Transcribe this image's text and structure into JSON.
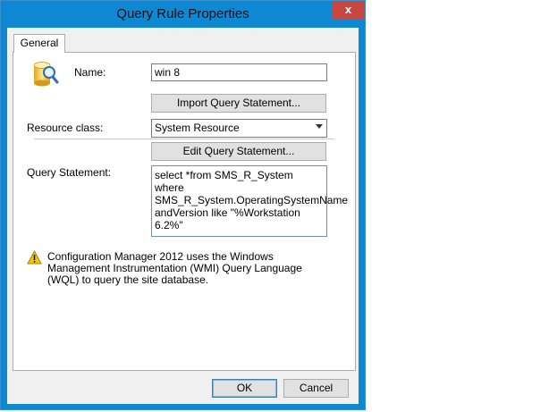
{
  "window": {
    "title": "Query Rule Properties",
    "close_glyph": "x"
  },
  "tabs": [
    {
      "label": "General"
    }
  ],
  "form": {
    "name_label": "Name:",
    "name_value": "win 8",
    "import_button": "Import Query Statement...",
    "resource_class_label": "Resource class:",
    "resource_class_value": "System Resource",
    "edit_button": "Edit Query Statement...",
    "query_statement_label": "Query Statement:",
    "query_statement_value": "select *from SMS_R_System where SMS_R_System.OperatingSystemName andVersion like \"%Workstation 6.2%\""
  },
  "info": {
    "icon": "warning-icon",
    "message": "Configuration Manager 2012 uses the Windows Management Instrumentation (WMI) Query Language (WQL) to query the site database."
  },
  "buttons": {
    "ok": "OK",
    "cancel": "Cancel"
  },
  "colors": {
    "title_bar": "#0f88d4",
    "close_button": "#c7463f",
    "warning": "#f2c40f"
  }
}
